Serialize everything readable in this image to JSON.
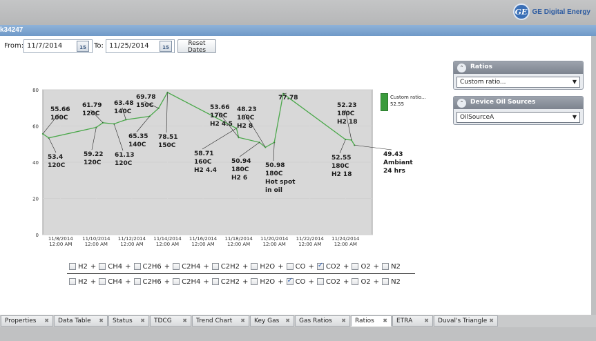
{
  "brand": {
    "logo": "GE",
    "text": "GE Digital Energy"
  },
  "window": {
    "title": "k34247"
  },
  "dates": {
    "from_label": "From:",
    "from_value": "11/7/2014",
    "to_label": "To:",
    "to_value": "11/25/2014",
    "calendar_glyph": "15",
    "reset_label": "Reset Dates"
  },
  "side": {
    "ratios_title": "Ratios",
    "ratios_value": "Custom ratio...",
    "sources_title": "Device Oil Sources",
    "sources_value": "OilSourceA"
  },
  "legend": {
    "line1": "Custom ratio...",
    "line2": "52.55",
    "color": "#3a9b3c"
  },
  "formula": {
    "numerator": [
      {
        "gas": "H2",
        "checked": false
      },
      {
        "gas": "CH4",
        "checked": false
      },
      {
        "gas": "C2H6",
        "checked": false
      },
      {
        "gas": "C2H4",
        "checked": false
      },
      {
        "gas": "C2H2",
        "checked": false
      },
      {
        "gas": "H2O",
        "checked": false
      },
      {
        "gas": "CO",
        "checked": false
      },
      {
        "gas": "CO2",
        "checked": true
      },
      {
        "gas": "O2",
        "checked": false
      },
      {
        "gas": "N2",
        "checked": false
      }
    ],
    "denominator": [
      {
        "gas": "H2",
        "checked": false
      },
      {
        "gas": "CH4",
        "checked": false
      },
      {
        "gas": "C2H6",
        "checked": false
      },
      {
        "gas": "C2H4",
        "checked": false
      },
      {
        "gas": "C2H2",
        "checked": false
      },
      {
        "gas": "H2O",
        "checked": false
      },
      {
        "gas": "CO",
        "checked": true
      },
      {
        "gas": "CO2",
        "checked": false
      },
      {
        "gas": "O2",
        "checked": false
      },
      {
        "gas": "N2",
        "checked": false
      }
    ]
  },
  "tabs": [
    {
      "label": "Properties",
      "active": false
    },
    {
      "label": "Data Table",
      "active": false
    },
    {
      "label": "Status",
      "active": false
    },
    {
      "label": "TDCG",
      "active": false
    },
    {
      "label": "Trend Chart",
      "active": false
    },
    {
      "label": "Key Gas",
      "active": false
    },
    {
      "label": "Gas Ratios",
      "active": false
    },
    {
      "label": "Ratios",
      "active": true
    },
    {
      "label": "ETRA",
      "active": false
    },
    {
      "label": "Duval's Triangle",
      "active": false
    }
  ],
  "tab_close_glyph": "✖",
  "chart_data": {
    "type": "line",
    "x_axis_type": "date",
    "ylim": [
      0,
      80
    ],
    "yticks": [
      0,
      20,
      40,
      60,
      80
    ],
    "xticks": [
      "11/8/2014 12:00 AM",
      "11/10/2014 12:00 AM",
      "11/12/2014 12:00 AM",
      "11/14/2014 12:00 AM",
      "11/16/2014 12:00 AM",
      "11/18/2014 12:00 AM",
      "11/20/2014 12:00 AM",
      "11/22/2014 12:00 AM",
      "11/24/2014 12:00 AM"
    ],
    "grid": true,
    "line_color": "#4aa84a",
    "series": [
      {
        "name": "Custom ratio...",
        "points": [
          {
            "x": "11/7/2014",
            "y": 55.66
          },
          {
            "x": "11/7/2014 8:00 AM",
            "y": 53.4
          },
          {
            "x": "11/10/2014",
            "y": 59.22
          },
          {
            "x": "11/10/2014 9:00 AM",
            "y": 61.79
          },
          {
            "x": "11/11/2014",
            "y": 61.13
          },
          {
            "x": "11/11/2014 4:00 PM",
            "y": 63.48
          },
          {
            "x": "11/13/2014",
            "y": 65.35
          },
          {
            "x": "11/13/2014 12:00 PM",
            "y": 69.78
          },
          {
            "x": "11/14/2014",
            "y": 78.51
          },
          {
            "x": "11/17/2014 9:00 PM",
            "y": 58.71
          },
          {
            "x": "11/18/2014",
            "y": 53.66
          },
          {
            "x": "11/19/2014 4:00 AM",
            "y": 50.94
          },
          {
            "x": "11/19/2014 12:00 PM",
            "y": 48.23
          },
          {
            "x": "11/20/2014",
            "y": 50.98
          },
          {
            "x": "11/20/2014 12:00 PM",
            "y": 77.78
          },
          {
            "x": "11/24/2014",
            "y": 52.55
          },
          {
            "x": "11/24/2014 8:00 AM",
            "y": 52.23
          },
          {
            "x": "11/24/2014 12:00 PM",
            "y": 49.43
          }
        ]
      }
    ],
    "annotations": [
      {
        "lines": [
          "55.66",
          "100C"
        ]
      },
      {
        "lines": [
          "53.4",
          "120C"
        ]
      },
      {
        "lines": [
          "61.79",
          "120C"
        ]
      },
      {
        "lines": [
          "59.22",
          "120C"
        ]
      },
      {
        "lines": [
          "63.48",
          "140C"
        ]
      },
      {
        "lines": [
          "61.13",
          "120C"
        ]
      },
      {
        "lines": [
          "69.78",
          "150C"
        ]
      },
      {
        "lines": [
          "65.35",
          "140C"
        ]
      },
      {
        "lines": [
          "78.51",
          "150C"
        ]
      },
      {
        "lines": [
          "53.66",
          "170C",
          "H2 4.5"
        ]
      },
      {
        "lines": [
          "48.23",
          "180C",
          "H2 8"
        ]
      },
      {
        "lines": [
          "58.71",
          "160C",
          "H2 4.4"
        ]
      },
      {
        "lines": [
          "50.94",
          "180C",
          "H2 6"
        ]
      },
      {
        "lines": [
          "50.98",
          "180C",
          "Hot spot",
          "in oil"
        ]
      },
      {
        "lines": [
          "77.78"
        ]
      },
      {
        "lines": [
          "52.23",
          "180C",
          "H2 18"
        ]
      },
      {
        "lines": [
          "52.55",
          "180C",
          "H2 18"
        ]
      },
      {
        "lines": [
          "49.43",
          "Ambiant",
          "24 hrs"
        ]
      }
    ]
  }
}
